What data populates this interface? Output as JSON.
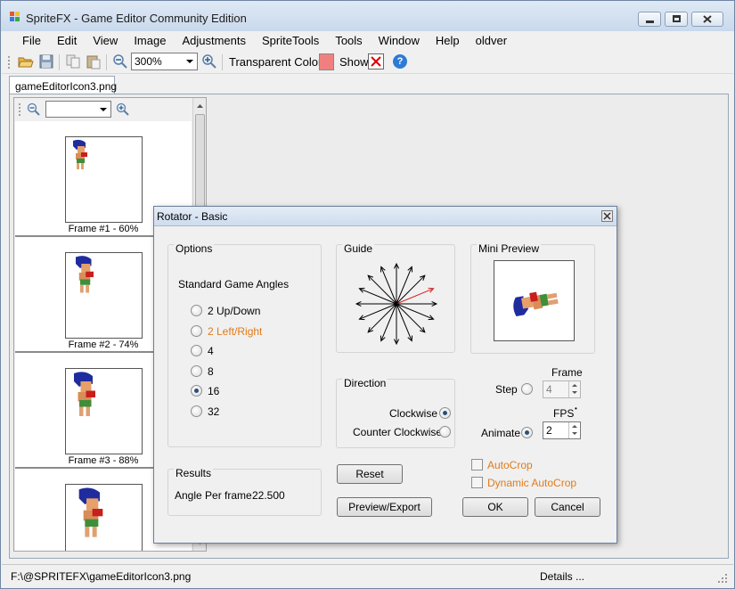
{
  "app": {
    "title": "SpriteFX - Game Editor Community Edition"
  },
  "menu": [
    "File",
    "Edit",
    "View",
    "Image",
    "Adjustments",
    "SpriteTools",
    "Tools",
    "Window",
    "Help",
    "oldver"
  ],
  "toolbar": {
    "zoom_value": "300%",
    "transparent_color_label": "Transparent Color",
    "transparent_color": "#f08080",
    "show_label": "Show"
  },
  "document": {
    "tab_label": "gameEditorIcon3.png"
  },
  "frames": [
    {
      "label": "Frame #1 - 60%"
    },
    {
      "label": "Frame #2 - 74%"
    },
    {
      "label": "Frame #3 - 88%"
    },
    {
      "label": ""
    }
  ],
  "status": {
    "path": "F:\\@SPRITEFX\\gameEditorIcon3.png",
    "details": "Details ..."
  },
  "dialog": {
    "title": "Rotator - Basic",
    "options": {
      "group_label": "Options",
      "heading": "Standard Game Angles",
      "angles": [
        {
          "label": "2 Up/Down",
          "checked": false,
          "highlight": false
        },
        {
          "label": "2 Left/Right",
          "checked": false,
          "highlight": true
        },
        {
          "label": "4",
          "checked": false,
          "highlight": false
        },
        {
          "label": "8",
          "checked": false,
          "highlight": false
        },
        {
          "label": "16",
          "checked": true,
          "highlight": false
        },
        {
          "label": "32",
          "checked": false,
          "highlight": false
        }
      ]
    },
    "guide": {
      "group_label": "Guide",
      "spokes": 16,
      "highlight_color": "#d02020"
    },
    "mini_preview": {
      "group_label": "Mini Preview"
    },
    "direction": {
      "group_label": "Direction",
      "clockwise_label": "Clockwise",
      "clockwise_checked": true,
      "counter_label": "Counter Clockwise",
      "counter_checked": false
    },
    "results": {
      "group_label": "Results",
      "angle_label": "Angle Per frame",
      "angle_value": "22.500"
    },
    "frame_label": "Frame",
    "step_label": "Step",
    "step_checked": false,
    "step_value": "4",
    "fps_label": "FPS",
    "animate_label": "Animate",
    "animate_checked": true,
    "fps_value": "2",
    "reset_label": "Reset",
    "preview_export_label": "Preview/Export",
    "autocrop_label": "AutoCrop",
    "dynamic_autocrop_label": "Dynamic AutoCrop",
    "ok_label": "OK",
    "cancel_label": "Cancel"
  }
}
